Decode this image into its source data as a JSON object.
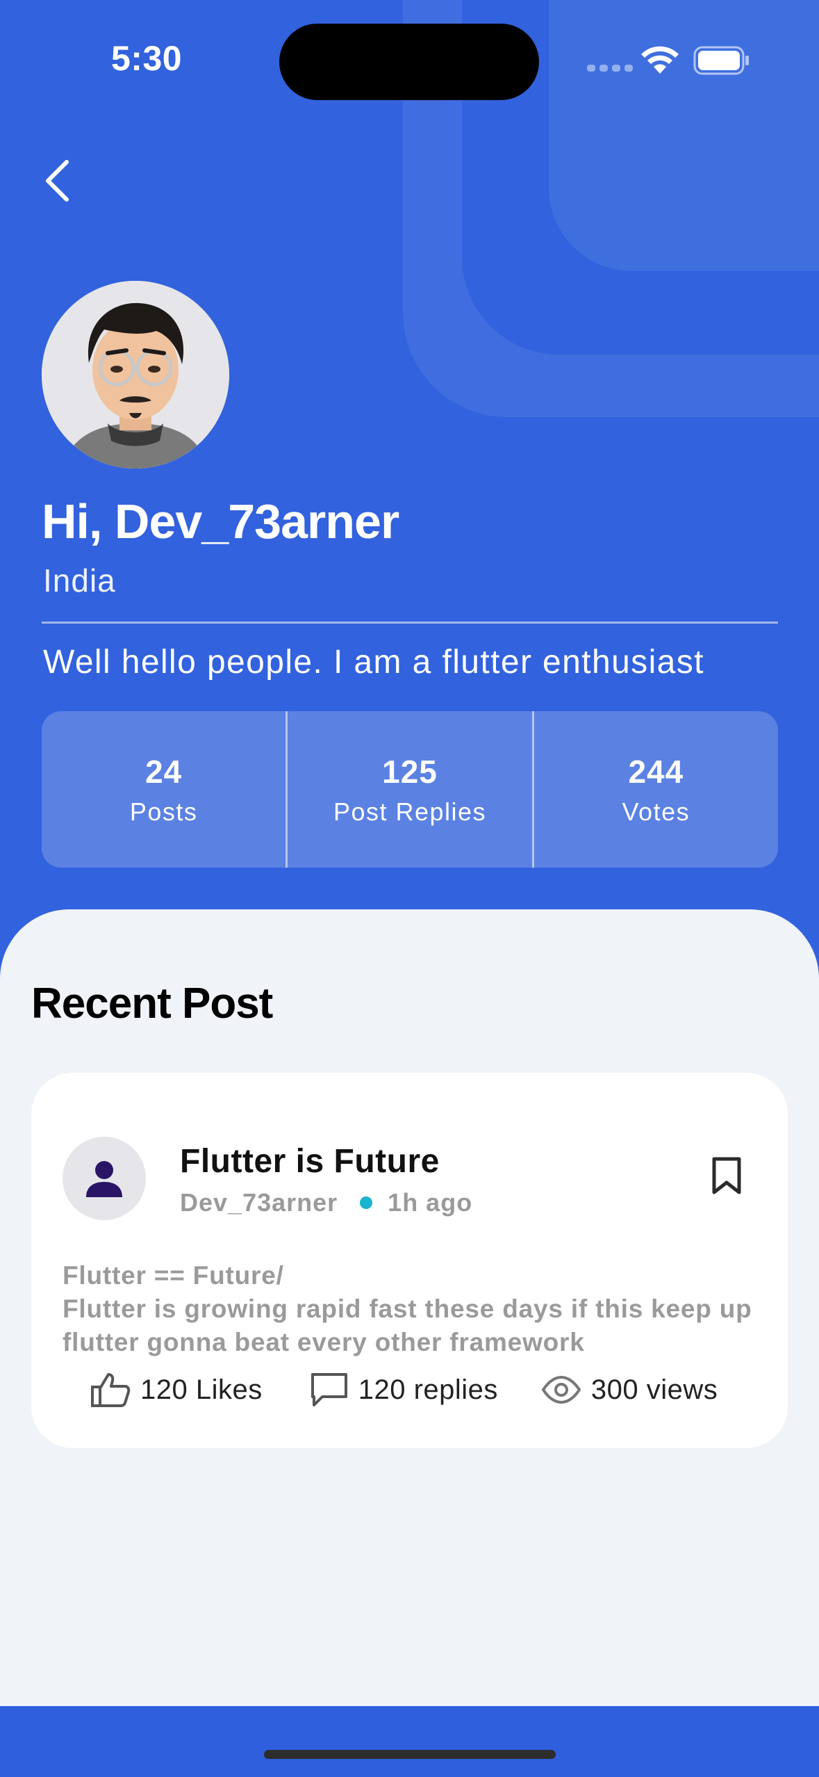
{
  "status_bar": {
    "time": "5:30"
  },
  "header": {
    "back_icon": "chevron-left-icon",
    "greeting": "Hi, Dev_73arner",
    "country": "India",
    "bio": "Well hello people. I am a flutter enthusiast"
  },
  "stats": [
    {
      "value": "24",
      "label": "Posts"
    },
    {
      "value": "125",
      "label": "Post Replies"
    },
    {
      "value": "244",
      "label": "Votes"
    }
  ],
  "recent": {
    "title": "Recent Post",
    "post": {
      "title": "Flutter is Future",
      "author": "Dev_73arner",
      "time": "1h ago",
      "body": "Flutter == Future/\n Flutter is growing rapid fast these days if this keep up flutter gonna beat every other framework",
      "likes": "120 Likes",
      "replies": "120 replies",
      "views": "300 views"
    }
  },
  "colors": {
    "header_blue": "#3262dd",
    "content_bg": "#f0f3f8",
    "dot_cyan": "#1ab3d0",
    "avatar_person": "#2a1466"
  }
}
